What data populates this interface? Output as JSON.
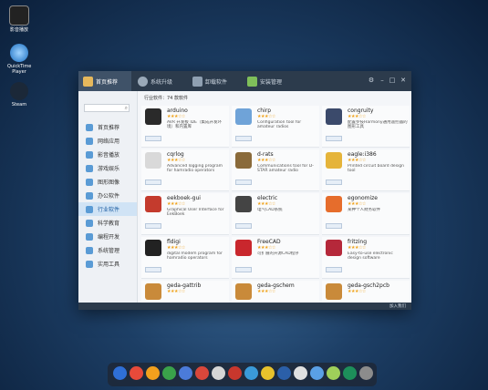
{
  "desktop_icons": [
    {
      "label": "影音播放"
    },
    {
      "label": "QuickTime Player"
    },
    {
      "label": "Steam"
    }
  ],
  "tabs": [
    {
      "label": "首页推荐"
    },
    {
      "label": "系统升级"
    },
    {
      "label": "卸载软件"
    },
    {
      "label": "安装管理"
    }
  ],
  "search": {
    "placeholder": ""
  },
  "categories": [
    {
      "label": "首页推荐"
    },
    {
      "label": "网络应用"
    },
    {
      "label": "影音播放"
    },
    {
      "label": "游戏娱乐"
    },
    {
      "label": "图形图像"
    },
    {
      "label": "办公软件"
    },
    {
      "label": "行业软件"
    },
    {
      "label": "科学教育"
    },
    {
      "label": "编程开发"
    },
    {
      "label": "系统管理"
    },
    {
      "label": "实用工具"
    }
  ],
  "breadcrumb": "行业软件：74 款软件",
  "apps": [
    {
      "name": "arduino",
      "stars": "★★★☆☆",
      "desc": "AVR 开发板 IDE（集成开发环境）和内置库",
      "color": "#2a2a2a"
    },
    {
      "name": "chirp",
      "stars": "★★★☆☆",
      "desc": "Configuration tool for amateur radios",
      "color": "#6fa3d8"
    },
    {
      "name": "congruity",
      "stars": "★★★☆☆",
      "desc": "配置罗技Harmony通用遥控器的图形工具",
      "color": "#3b4a6b"
    },
    {
      "name": "cqrlog",
      "stars": "★★★☆☆",
      "desc": "Advanced logging program for hamradio operators",
      "color": "#d9d9d9"
    },
    {
      "name": "d-rats",
      "stars": "★★★☆☆",
      "desc": "Communications tool for D-STAR amateur radio",
      "color": "#8a6a3a"
    },
    {
      "name": "eagle:i386",
      "stars": "★★★☆☆",
      "desc": "Printed circuit board design tool",
      "color": "#e5b43a"
    },
    {
      "name": "eekboek-gui",
      "stars": "★★★☆☆",
      "desc": "Graphical User Interface for EekBoek",
      "color": "#c43b2d"
    },
    {
      "name": "electric",
      "stars": "★★★☆☆",
      "desc": "电气CAD系统",
      "color": "#444444"
    },
    {
      "name": "egonomize",
      "stars": "★★★☆☆",
      "desc": "某种个人财务软件",
      "color": "#e66d2c"
    },
    {
      "name": "fldigi",
      "stars": "★★★☆☆",
      "desc": "digital modem program for hamradio operators",
      "color": "#222222"
    },
    {
      "name": "FreeCAD",
      "stars": "★★★☆☆",
      "desc": "可扩展的开源CAD程序",
      "color": "#c9272d"
    },
    {
      "name": "fritzing",
      "stars": "★★★☆☆",
      "desc": "Easy-to-use electronic design software",
      "color": "#b5283a"
    },
    {
      "name": "geda-gattrib",
      "stars": "★★★☆☆",
      "desc": "",
      "color": "#c98a3a"
    },
    {
      "name": "geda-gschem",
      "stars": "★★★☆☆",
      "desc": "",
      "color": "#c98a3a"
    },
    {
      "name": "geda-gsch2pcb",
      "stars": "★★★☆☆",
      "desc": "",
      "color": "#c98a3a"
    }
  ],
  "statusbar": {
    "text": "加入我们"
  },
  "dock": {
    "count": 16
  }
}
